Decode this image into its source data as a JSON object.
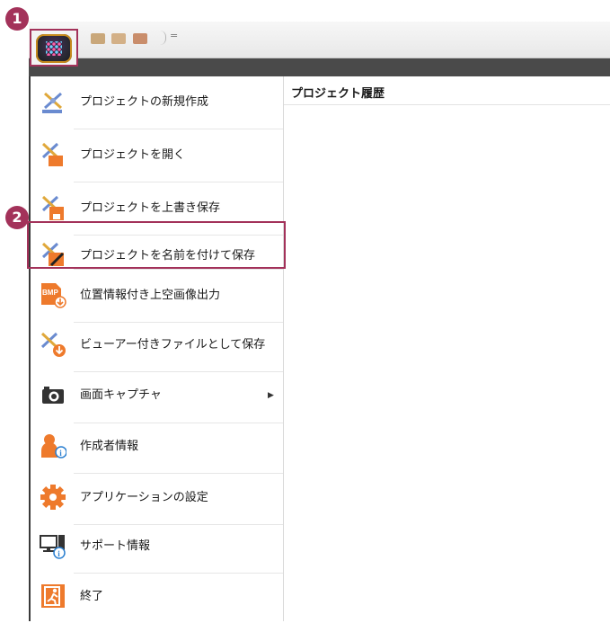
{
  "steps": {
    "one": "1",
    "two": "2"
  },
  "history": {
    "title": "プロジェクト履歴"
  },
  "quick_access": {
    "dropdown": "="
  },
  "menu": {
    "items": [
      {
        "label": "プロジェクトの新規作成",
        "icon": "new-project-icon"
      },
      {
        "label": "プロジェクトを開く",
        "icon": "open-project-icon"
      },
      {
        "label": "プロジェクトを上書き保存",
        "icon": "save-project-icon"
      },
      {
        "label": "プロジェクトを名前を付けて保存",
        "icon": "save-as-icon"
      },
      {
        "label": "位置情報付き上空画像出力",
        "icon": "bmp-export-icon"
      },
      {
        "label": "ビューアー付きファイルとして保存",
        "icon": "viewer-save-icon"
      },
      {
        "label": "画面キャプチャ",
        "icon": "camera-icon",
        "submenu_arrow": "▶"
      },
      {
        "label": "作成者情報",
        "icon": "author-info-icon"
      },
      {
        "label": "アプリケーションの設定",
        "icon": "settings-gear-icon"
      },
      {
        "label": "サポート情報",
        "icon": "support-info-icon"
      },
      {
        "label": "終了",
        "icon": "exit-icon"
      }
    ]
  },
  "colors": {
    "accent": "#a3325a",
    "dark_bar": "#4a4a4a",
    "orange": "#ee7a2c"
  }
}
